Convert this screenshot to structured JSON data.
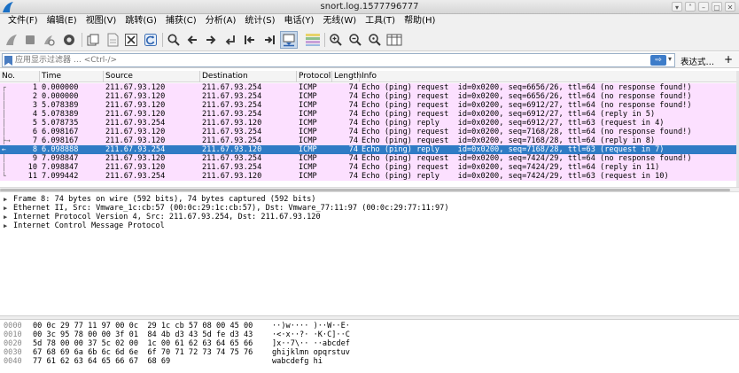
{
  "window": {
    "title": "snort.log.1577796777",
    "controls": [
      "▾",
      "˄",
      "–",
      "▢",
      "✕"
    ]
  },
  "menu": [
    "文件(F)",
    "编辑(E)",
    "视图(V)",
    "跳转(G)",
    "捕获(C)",
    "分析(A)",
    "统计(S)",
    "电话(Y)",
    "无线(W)",
    "工具(T)",
    "帮助(H)"
  ],
  "toolbar": {
    "icons": [
      "shark-fin-start-icon",
      "stop-capture-icon",
      "restart-capture-icon",
      "capture-options-icon",
      "open-file-icon",
      "save-file-icon",
      "close-file-icon",
      "reload-file-icon",
      "find-packet-icon",
      "go-back-icon",
      "go-forward-icon",
      "go-to-packet-icon",
      "first-packet-icon",
      "last-packet-icon",
      "autoscroll-icon",
      "colorize-icon",
      "zoom-in-icon",
      "zoom-out-icon",
      "normal-size-icon",
      "resize-columns-icon"
    ]
  },
  "filter": {
    "placeholder": "应用显示过滤器 … <Ctrl-/>",
    "apply_label": "⇨",
    "dropdown_label": "▾",
    "expression_label": "表达式…",
    "add_label": "+"
  },
  "packet_list": {
    "columns": [
      "No.",
      "Time",
      "Source",
      "Destination",
      "Protocol",
      "Length",
      "Info"
    ],
    "rows": [
      {
        "no": "1",
        "time": "0.000000",
        "src": "211.67.93.120",
        "dst": "211.67.93.254",
        "proto": "ICMP",
        "len": "74",
        "info": "Echo (ping) request  id=0x0200, seq=6656/26, ttl=64 (no response found!)",
        "rel": "┌",
        "sel": false
      },
      {
        "no": "2",
        "time": "0.000000",
        "src": "211.67.93.120",
        "dst": "211.67.93.254",
        "proto": "ICMP",
        "len": "74",
        "info": "Echo (ping) request  id=0x0200, seq=6656/26, ttl=64 (no response found!)",
        "rel": "│",
        "sel": false
      },
      {
        "no": "3",
        "time": "5.078389",
        "src": "211.67.93.120",
        "dst": "211.67.93.254",
        "proto": "ICMP",
        "len": "74",
        "info": "Echo (ping) request  id=0x0200, seq=6912/27, ttl=64 (no response found!)",
        "rel": "│",
        "sel": false
      },
      {
        "no": "4",
        "time": "5.078389",
        "src": "211.67.93.120",
        "dst": "211.67.93.254",
        "proto": "ICMP",
        "len": "74",
        "info": "Echo (ping) request  id=0x0200, seq=6912/27, ttl=64 (reply in 5)",
        "rel": "│",
        "sel": false
      },
      {
        "no": "5",
        "time": "5.078735",
        "src": "211.67.93.254",
        "dst": "211.67.93.120",
        "proto": "ICMP",
        "len": "74",
        "info": "Echo (ping) reply    id=0x0200, seq=6912/27, ttl=63 (request in 4)",
        "rel": "│",
        "sel": false
      },
      {
        "no": "6",
        "time": "6.098167",
        "src": "211.67.93.120",
        "dst": "211.67.93.254",
        "proto": "ICMP",
        "len": "74",
        "info": "Echo (ping) request  id=0x0200, seq=7168/28, ttl=64 (no response found!)",
        "rel": "│",
        "sel": false
      },
      {
        "no": "7",
        "time": "6.098167",
        "src": "211.67.93.120",
        "dst": "211.67.93.254",
        "proto": "ICMP",
        "len": "74",
        "info": "Echo (ping) request  id=0x0200, seq=7168/28, ttl=64 (reply in 8)",
        "rel": "├→",
        "sel": false
      },
      {
        "no": "8",
        "time": "6.098888",
        "src": "211.67.93.254",
        "dst": "211.67.93.120",
        "proto": "ICMP",
        "len": "74",
        "info": "Echo (ping) reply    id=0x0200, seq=7168/28, ttl=63 (request in 7)",
        "rel": "←",
        "sel": true
      },
      {
        "no": "9",
        "time": "7.098847",
        "src": "211.67.93.120",
        "dst": "211.67.93.254",
        "proto": "ICMP",
        "len": "74",
        "info": "Echo (ping) request  id=0x0200, seq=7424/29, ttl=64 (no response found!)",
        "rel": "│",
        "sel": false
      },
      {
        "no": "10",
        "time": "7.098847",
        "src": "211.67.93.120",
        "dst": "211.67.93.254",
        "proto": "ICMP",
        "len": "74",
        "info": "Echo (ping) request  id=0x0200, seq=7424/29, ttl=64 (reply in 11)",
        "rel": "│",
        "sel": false
      },
      {
        "no": "11",
        "time": "7.099442",
        "src": "211.67.93.254",
        "dst": "211.67.93.120",
        "proto": "ICMP",
        "len": "74",
        "info": "Echo (ping) reply    id=0x0200, seq=7424/29, ttl=63 (request in 10)",
        "rel": "└",
        "sel": false
      }
    ]
  },
  "details": [
    "Frame 8: 74 bytes on wire (592 bits), 74 bytes captured (592 bits)",
    "Ethernet II, Src: Vmware_1c:cb:57 (00:0c:29:1c:cb:57), Dst: Vmware_77:11:97 (00:0c:29:77:11:97)",
    "Internet Protocol Version 4, Src: 211.67.93.254, Dst: 211.67.93.120",
    "Internet Control Message Protocol"
  ],
  "bytes": [
    {
      "offset": "0000",
      "hex": "00 0c 29 77 11 97 00 0c  29 1c cb 57 08 00 45 00",
      "ascii": "··)w···· )··W··E·"
    },
    {
      "offset": "0010",
      "hex": "00 3c 95 78 00 00 3f 01  84 4b d3 43 5d fe d3 43",
      "ascii": "·<·x··?· ·K·C]··C"
    },
    {
      "offset": "0020",
      "hex": "5d 78 00 00 37 5c 02 00  1c 00 61 62 63 64 65 66",
      "ascii": "]x··7\\·· ··abcdef"
    },
    {
      "offset": "0030",
      "hex": "67 68 69 6a 6b 6c 6d 6e  6f 70 71 72 73 74 75 76",
      "ascii": "ghijklmn opqrstuv"
    },
    {
      "offset": "0040",
      "hex": "77 61 62 63 64 65 66 67  68 69",
      "ascii": "wabcdefg hi"
    }
  ],
  "colors": {
    "icmp_row": "#fce0ff",
    "selected_row": "#2f7bc5",
    "filter_apply": "#3d7cc9"
  }
}
